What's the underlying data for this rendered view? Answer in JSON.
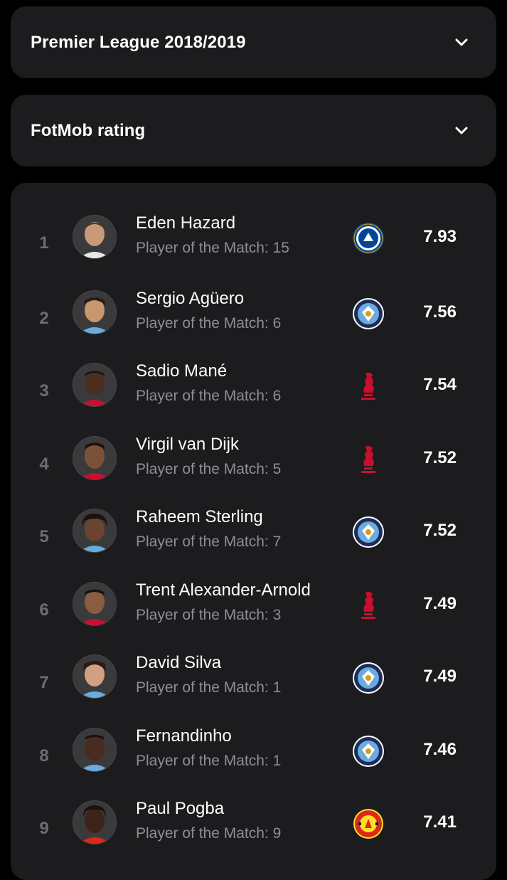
{
  "filters": {
    "season": {
      "label": "Premier League 2018/2019",
      "icon": "chevron-down-icon"
    },
    "stat": {
      "label": "FotMob rating",
      "icon": "chevron-down-icon"
    }
  },
  "colors": {
    "background": "#000000",
    "card": "#1c1c1e",
    "primary_text": "#ffffff",
    "secondary_text": "#8e8e93",
    "rank_text": "#6e6e72",
    "chelsea": "#034694",
    "man_city": "#6cabdd",
    "liverpool": "#c8102e",
    "man_united": "#da291c"
  },
  "players": [
    {
      "rank": "1",
      "name": "Eden Hazard",
      "potm": "Player of the Match: 15",
      "club": "chelsea-crest-icon",
      "rating": "7.93"
    },
    {
      "rank": "2",
      "name": "Sergio Agüero",
      "potm": "Player of the Match: 6",
      "club": "man-city-crest-icon",
      "rating": "7.56"
    },
    {
      "rank": "3",
      "name": "Sadio Mané",
      "potm": "Player of the Match: 6",
      "club": "liverpool-crest-icon",
      "rating": "7.54"
    },
    {
      "rank": "4",
      "name": "Virgil van Dijk",
      "potm": "Player of the Match: 5",
      "club": "liverpool-crest-icon",
      "rating": "7.52"
    },
    {
      "rank": "5",
      "name": "Raheem Sterling",
      "potm": "Player of the Match: 7",
      "club": "man-city-crest-icon",
      "rating": "7.52"
    },
    {
      "rank": "6",
      "name": "Trent Alexander-Arnold",
      "potm": "Player of the Match: 3",
      "club": "liverpool-crest-icon",
      "rating": "7.49"
    },
    {
      "rank": "7",
      "name": "David Silva",
      "potm": "Player of the Match: 1",
      "club": "man-city-crest-icon",
      "rating": "7.49"
    },
    {
      "rank": "8",
      "name": "Fernandinho",
      "potm": "Player of the Match: 1",
      "club": "man-city-crest-icon",
      "rating": "7.46"
    },
    {
      "rank": "9",
      "name": "Paul Pogba",
      "potm": "Player of the Match: 9",
      "club": "man-united-crest-icon",
      "rating": "7.41"
    }
  ]
}
